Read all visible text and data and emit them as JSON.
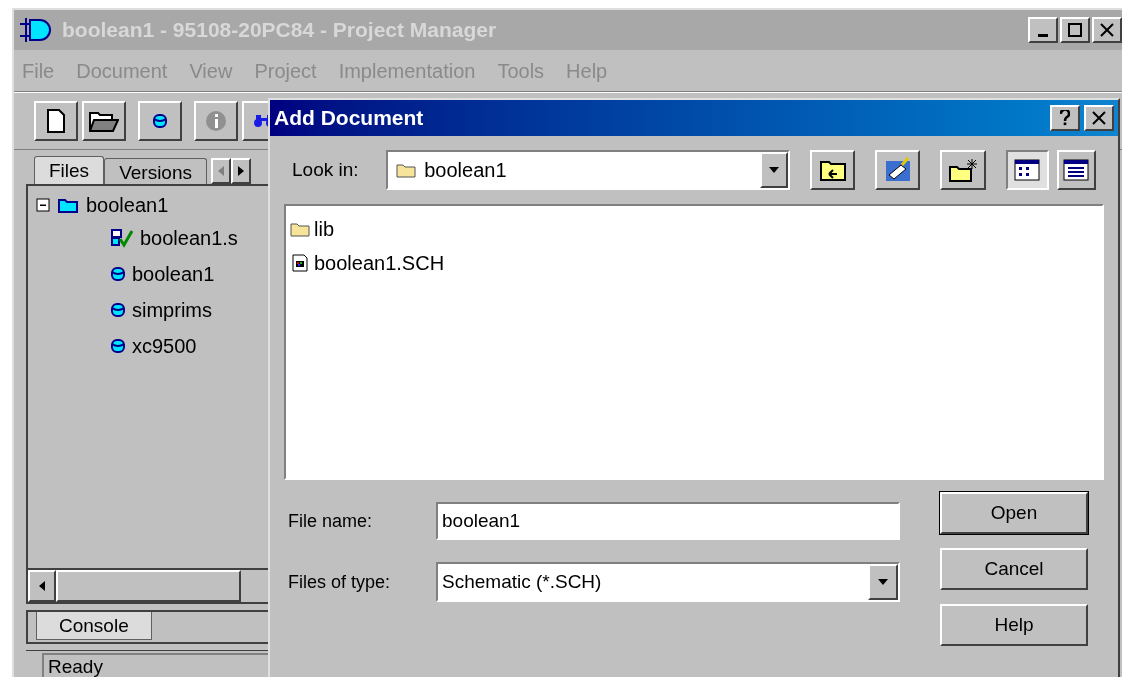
{
  "main_window": {
    "title": "boolean1 - 95108-20PC84 - Project Manager"
  },
  "menu": [
    "File",
    "Document",
    "View",
    "Project",
    "Implementation",
    "Tools",
    "Help"
  ],
  "panel_tabs": [
    {
      "label": "Files",
      "selected": true
    },
    {
      "label": "Versions",
      "selected": false
    }
  ],
  "tree": [
    {
      "label": "boolean1",
      "kind": "folder",
      "expanded": true,
      "children": [
        {
          "label": "boolean1.s",
          "kind": "schematic"
        },
        {
          "label": "boolean1",
          "kind": "library"
        },
        {
          "label": "simprims",
          "kind": "library"
        },
        {
          "label": "xc9500",
          "kind": "library"
        }
      ]
    }
  ],
  "console_tab": {
    "label": "Console",
    "selected": true
  },
  "status_bar": "Ready",
  "dialog": {
    "title": "Add Document",
    "look_in_label": "Look in:",
    "look_in_value": "boolean1",
    "files": [
      {
        "name": "lib",
        "kind": "folder"
      },
      {
        "name": "boolean1.SCH",
        "kind": "schematic"
      }
    ],
    "file_name_label": "File name:",
    "file_name_value": "boolean1",
    "file_type_label": "Files of type:",
    "file_type_value": "Schematic (*.SCH)",
    "buttons": [
      "Open",
      "Cancel",
      "Help"
    ]
  }
}
